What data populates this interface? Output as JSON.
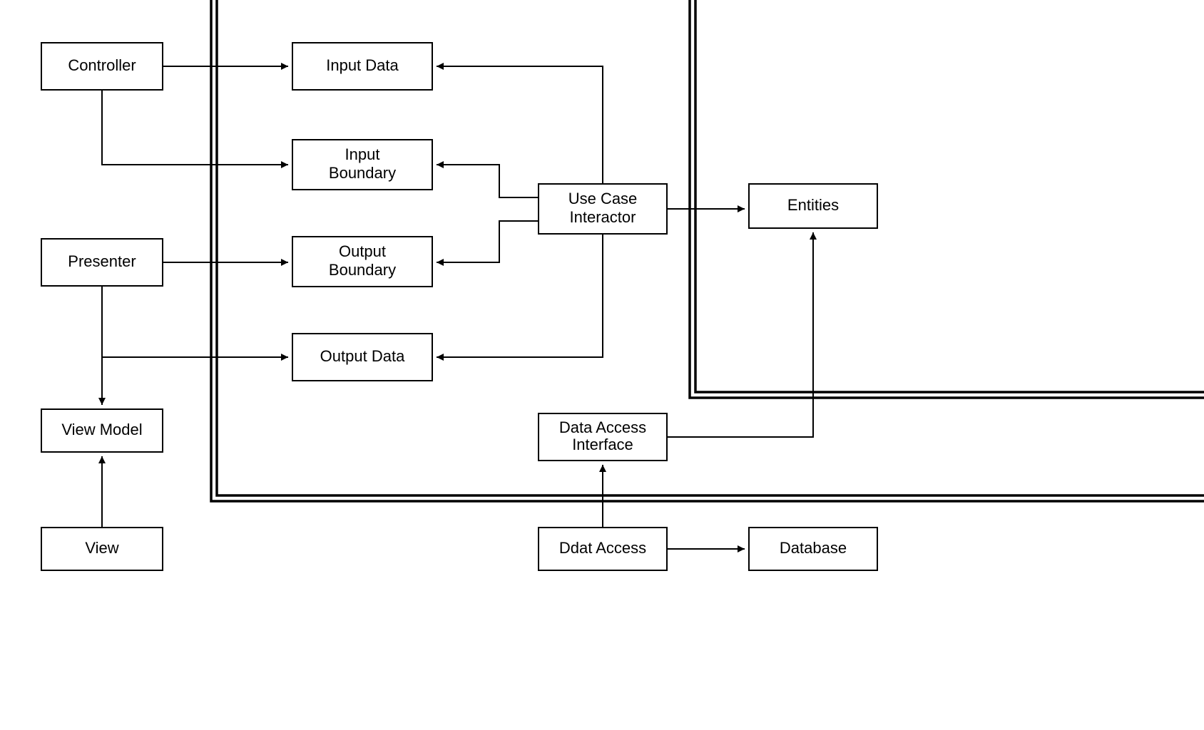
{
  "diagram": {
    "type": "architecture-box-arrow",
    "boxes": {
      "controller": "Controller",
      "presenter": "Presenter",
      "view_model": "View Model",
      "view": "View",
      "input_data": "Input Data",
      "input_boundary_l1": "Input",
      "input_boundary_l2": "Boundary",
      "output_boundary_l1": "Output",
      "output_boundary_l2": "Boundary",
      "output_data": "Output Data",
      "use_case_l1": "Use Case",
      "use_case_l2": "Interactor",
      "data_access_if_l1": "Data Access",
      "data_access_if_l2": "Interface",
      "data_access": "Ddat Access",
      "entities": "Entities",
      "database": "Database"
    }
  }
}
